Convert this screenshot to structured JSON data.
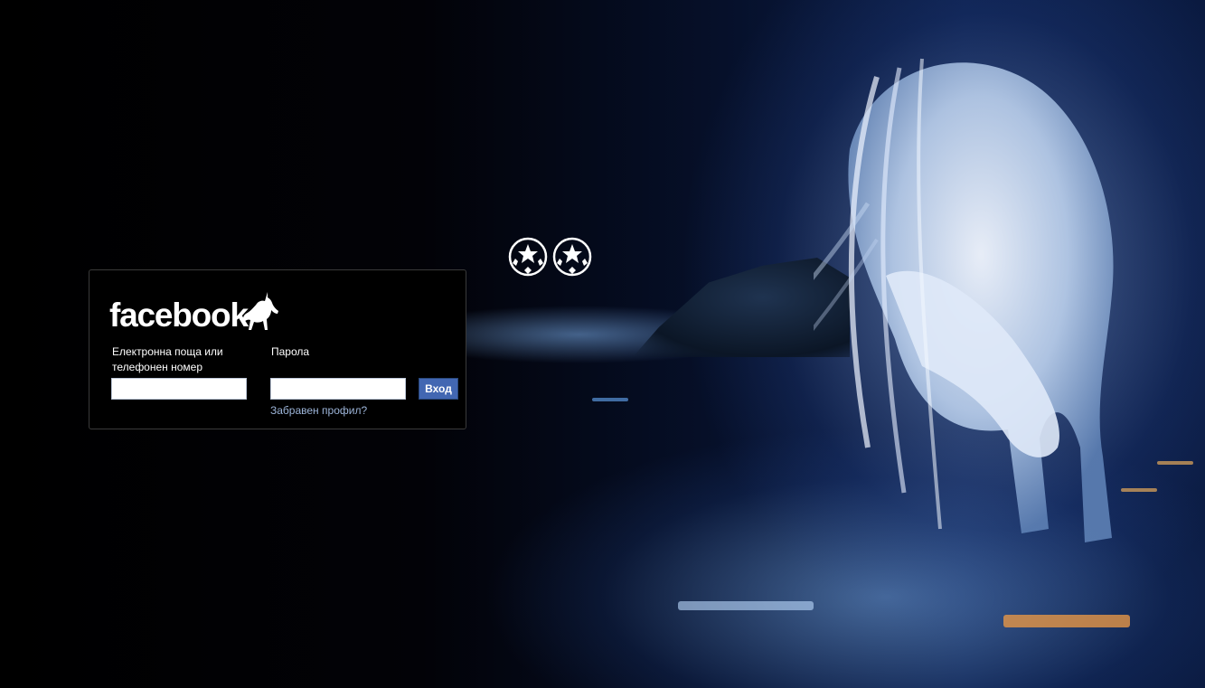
{
  "login": {
    "logo_text": "facebook",
    "email_label": "Електронна поща или телефонен номер",
    "email_value": "",
    "password_label": "Парола",
    "password_value": "",
    "login_button_label": "Вход",
    "forgot_link_label": "Забравен профил?"
  },
  "decorations": {
    "background": "unicorn-at-water-night-icon",
    "logo_mascot": "unicorn-icon",
    "balls": [
      "champions-league-ball-icon",
      "champions-league-ball-icon"
    ]
  },
  "colors": {
    "button_bg": "#4267b2",
    "link": "#9cb4d8",
    "panel_bg": "#000000",
    "panel_border": "#3a3a3a"
  }
}
